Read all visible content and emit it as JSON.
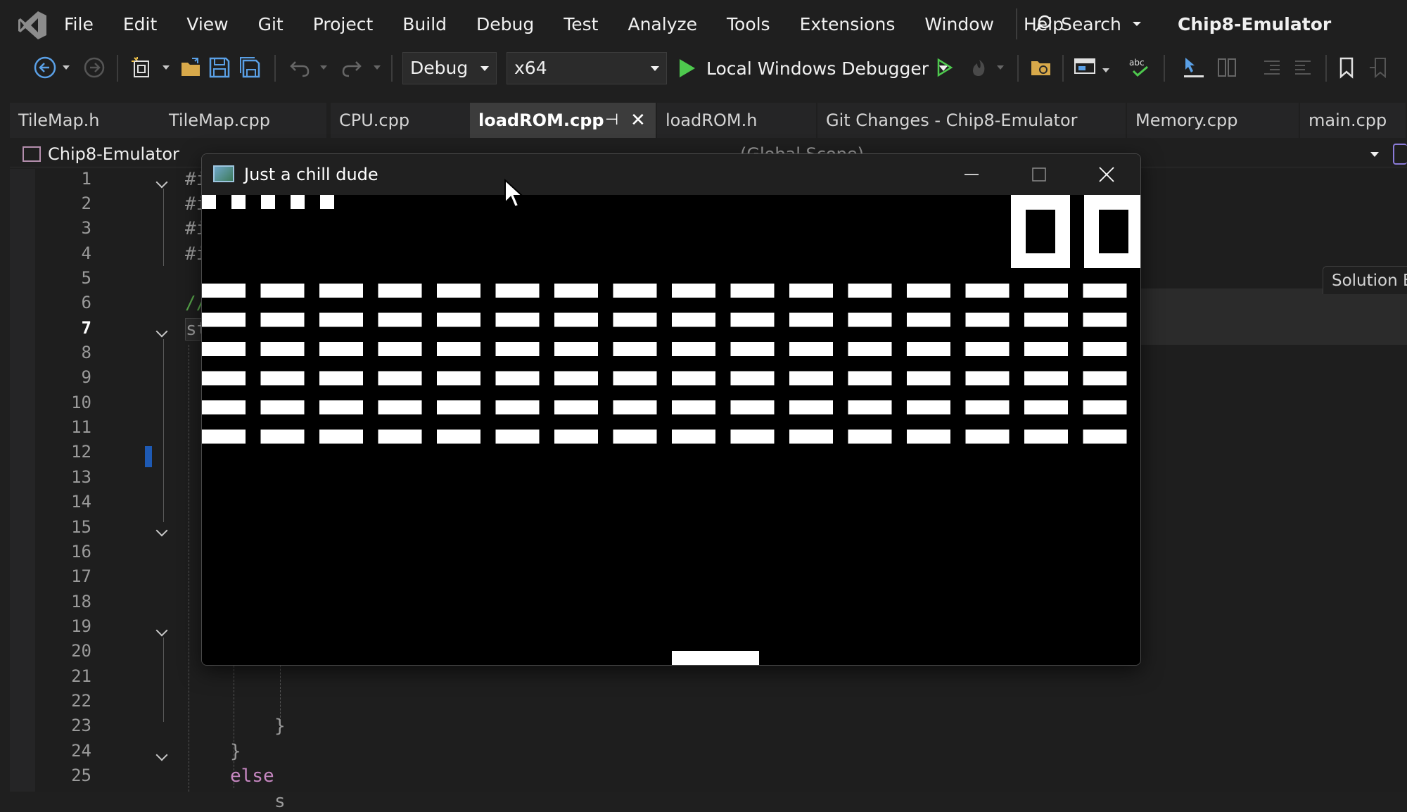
{
  "menubar": {
    "items": [
      "File",
      "Edit",
      "View",
      "Git",
      "Project",
      "Build",
      "Debug",
      "Test",
      "Analyze",
      "Tools",
      "Extensions",
      "Window",
      "Help"
    ],
    "search_label": "Search",
    "solution_name": "Chip8-Emulator"
  },
  "toolbar": {
    "configuration": "Debug",
    "platform": "x64",
    "debugger_label": "Local Windows Debugger"
  },
  "tabs": [
    {
      "label": "TileMap.h",
      "active": false
    },
    {
      "label": "TileMap.cpp",
      "active": false
    },
    {
      "label": "CPU.cpp",
      "active": false
    },
    {
      "label": "loadROM.cpp",
      "active": true
    },
    {
      "label": "loadROM.h",
      "active": false
    },
    {
      "label": "Git Changes - Chip8-Emulator",
      "active": false
    },
    {
      "label": "Memory.cpp",
      "active": false
    },
    {
      "label": "main.cpp",
      "active": false
    }
  ],
  "editor": {
    "project": "Chip8-Emulator",
    "scope": "(Global Scope)",
    "current_line": 7,
    "line_numbers": [
      "1",
      "2",
      "3",
      "4",
      "5",
      "6",
      "7",
      "8",
      "9",
      "10",
      "11",
      "12",
      "13",
      "14",
      "15",
      "16",
      "17",
      "18",
      "19",
      "20",
      "21",
      "22",
      "23",
      "24",
      "25"
    ],
    "visible_code": {
      "l1": "#i",
      "l2": "#i",
      "l3": "#i",
      "l4": "#i",
      "l6": "//",
      "l7": "st",
      "l22": "}",
      "l23": "}",
      "l24": "else",
      "l25": "s"
    }
  },
  "right_panel": {
    "solution_tab": "Solution E"
  },
  "game_window": {
    "title": "Just a chill dude",
    "brick_rows": 6,
    "brick_columns": 16,
    "lives_indicator_count": 5,
    "score_digits": "00"
  },
  "colors": {
    "ide_background": "#1f1f1f",
    "editor_background": "#1e1e1e",
    "game_background": "#000000",
    "game_foreground": "#ffffff",
    "run_green": "#4ec94e",
    "keyword_purple": "#c586c0"
  }
}
